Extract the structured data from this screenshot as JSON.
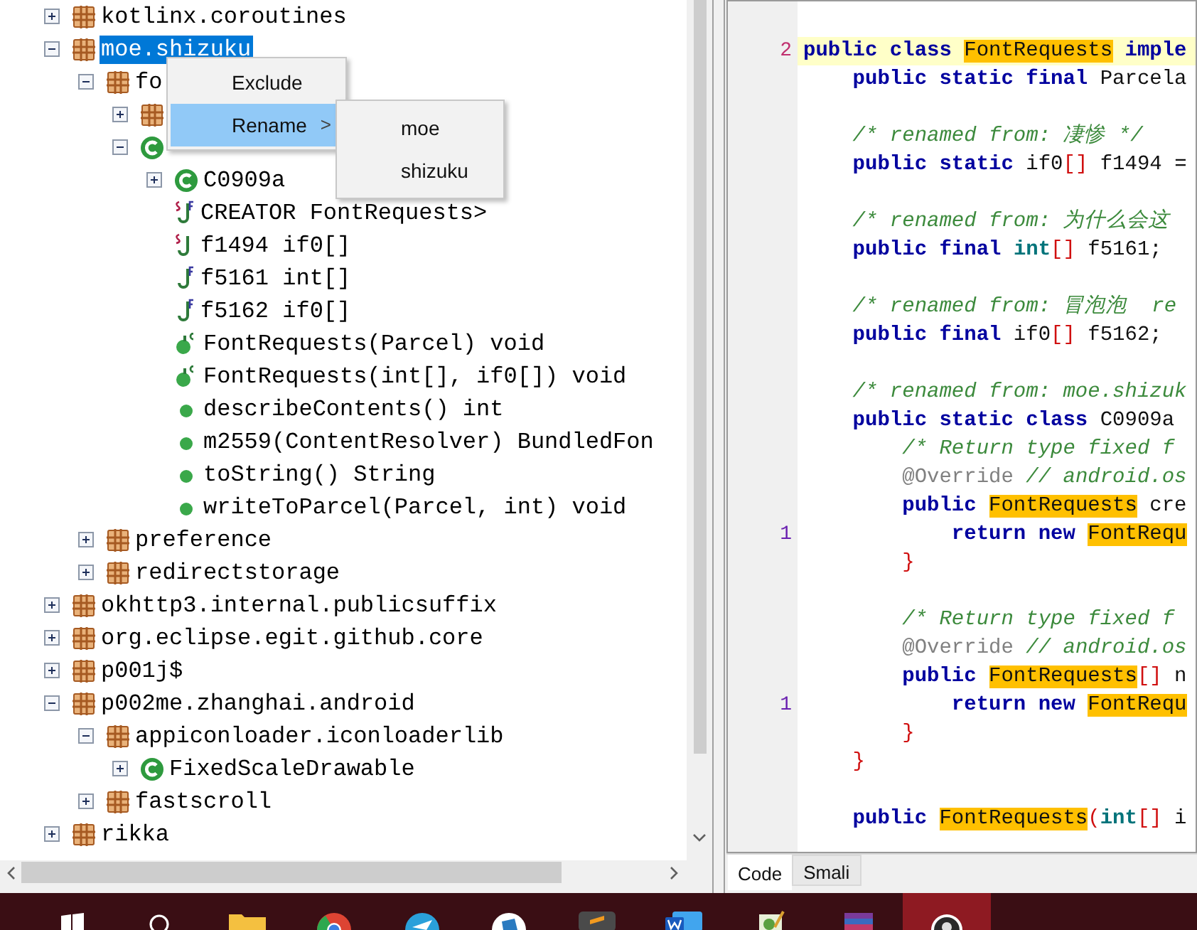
{
  "tree": {
    "nodes": [
      {
        "kind": "package",
        "label": "kotlinx.coroutines",
        "expanded": false,
        "selected": false
      },
      {
        "kind": "package",
        "label": "moe.shizuku",
        "expanded": true,
        "selected": true,
        "children": [
          {
            "kind": "package",
            "label": "fo",
            "expanded": true,
            "selected": false,
            "children": [
              {
                "kind": "package",
                "expanded": false,
                "selected": false
              },
              {
                "kind": "class",
                "expanded": true,
                "selected": false,
                "children": [
                  {
                    "kind": "class",
                    "label": "C0909a",
                    "expanded": false,
                    "selected": false
                  },
                  {
                    "kind": "field",
                    "static": true,
                    "final": true,
                    "label": "CREATOR FontRequests>",
                    "selected": false
                  },
                  {
                    "kind": "field",
                    "static": true,
                    "final": false,
                    "label": "f1494 if0[]",
                    "selected": false
                  },
                  {
                    "kind": "field",
                    "static": false,
                    "final": true,
                    "label": "f5161 int[]",
                    "selected": false
                  },
                  {
                    "kind": "field",
                    "static": false,
                    "final": true,
                    "label": "f5162 if0[]",
                    "selected": false
                  },
                  {
                    "kind": "constructor",
                    "label": "FontRequests(Parcel) void",
                    "selected": false
                  },
                  {
                    "kind": "constructor",
                    "label": "FontRequests(int[], if0[]) void",
                    "selected": false
                  },
                  {
                    "kind": "method",
                    "label": "describeContents() int",
                    "selected": false
                  },
                  {
                    "kind": "method",
                    "label": "m2559(ContentResolver) BundledFon",
                    "selected": false
                  },
                  {
                    "kind": "method",
                    "label": "toString() String",
                    "selected": false
                  },
                  {
                    "kind": "method",
                    "label": "writeToParcel(Parcel, int) void",
                    "selected": false
                  }
                ]
              }
            ]
          },
          {
            "kind": "package",
            "label": "preference",
            "expanded": false,
            "selected": false
          },
          {
            "kind": "package",
            "label": "redirectstorage",
            "expanded": false,
            "selected": false
          }
        ]
      },
      {
        "kind": "package",
        "label": "okhttp3.internal.publicsuffix",
        "expanded": false,
        "selected": false
      },
      {
        "kind": "package",
        "label": "org.eclipse.egit.github.core",
        "expanded": false,
        "selected": false
      },
      {
        "kind": "package",
        "label": "p001j$",
        "expanded": false,
        "selected": false
      },
      {
        "kind": "package",
        "label": "p002me.zhanghai.android",
        "expanded": true,
        "selected": false,
        "children": [
          {
            "kind": "package",
            "label": "appiconloader.iconloaderlib",
            "expanded": true,
            "selected": false,
            "children": [
              {
                "kind": "class",
                "label": "FixedScaleDrawable",
                "expanded": false,
                "selected": false
              }
            ]
          },
          {
            "kind": "package",
            "label": "fastscroll",
            "expanded": false,
            "selected": false
          }
        ]
      },
      {
        "kind": "package",
        "label": "rikka",
        "expanded": false,
        "selected": false
      }
    ]
  },
  "context_menu": {
    "items": [
      {
        "label": "Exclude",
        "selected": false
      },
      {
        "label": "Rename",
        "selected": true,
        "arrow": ">"
      }
    ]
  },
  "submenu": {
    "items": [
      {
        "label": "moe",
        "selected": false
      },
      {
        "label": "shizuku",
        "selected": false
      }
    ]
  },
  "editor": {
    "lines": [
      {
        "gutter": "2",
        "highlight": true,
        "tokens": [
          {
            "text": "public class ",
            "kind": "keyword"
          },
          {
            "text": "FontRequests",
            "kind": "match"
          },
          {
            "text": " imple",
            "kind": "keyword"
          }
        ]
      },
      {
        "highlight": false,
        "tokens": [
          {
            "text": "    public static final",
            "kind": "keyword"
          },
          {
            "text": " Parcela",
            "kind": "plain"
          }
        ]
      },
      {
        "highlight": false
      },
      {
        "highlight": false,
        "tokens": [
          {
            "text": "    /* renamed from: 凄惨 */",
            "kind": "comment"
          }
        ]
      },
      {
        "highlight": false,
        "tokens": [
          {
            "text": "    public static",
            "kind": "keyword"
          },
          {
            "text": " if0",
            "kind": "plain"
          },
          {
            "text": "[]",
            "kind": "bracket"
          },
          {
            "text": " f1494 =",
            "kind": "plain"
          }
        ]
      },
      {
        "highlight": false
      },
      {
        "highlight": false,
        "tokens": [
          {
            "text": "    /* renamed from: 为什么会这",
            "kind": "comment"
          }
        ]
      },
      {
        "highlight": false,
        "tokens": [
          {
            "text": "    public final ",
            "kind": "keyword"
          },
          {
            "text": "int",
            "kind": "type"
          },
          {
            "text": "[]",
            "kind": "bracket"
          },
          {
            "text": " f5161;",
            "kind": "plain"
          }
        ]
      },
      {
        "highlight": false
      },
      {
        "highlight": false,
        "tokens": [
          {
            "text": "    /* renamed from: 冒泡泡  re",
            "kind": "comment"
          }
        ]
      },
      {
        "highlight": false,
        "tokens": [
          {
            "text": "    public final",
            "kind": "keyword"
          },
          {
            "text": " if0",
            "kind": "plain"
          },
          {
            "text": "[]",
            "kind": "bracket"
          },
          {
            "text": " f5162;",
            "kind": "plain"
          }
        ]
      },
      {
        "highlight": false
      },
      {
        "highlight": false,
        "tokens": [
          {
            "text": "    /* renamed from: moe.shizuk",
            "kind": "comment"
          }
        ]
      },
      {
        "highlight": false,
        "tokens": [
          {
            "text": "    public static class",
            "kind": "keyword"
          },
          {
            "text": " C0909a",
            "kind": "plain"
          }
        ]
      },
      {
        "highlight": false,
        "tokens": [
          {
            "text": "        /* Return type fixed f",
            "kind": "comment"
          }
        ]
      },
      {
        "highlight": false,
        "tokens": [
          {
            "text": "        @Override",
            "kind": "annotation"
          },
          {
            "text": " // android.os",
            "kind": "comment"
          }
        ]
      },
      {
        "highlight": false,
        "tokens": [
          {
            "text": "        public ",
            "kind": "keyword"
          },
          {
            "text": "FontRequests",
            "kind": "match"
          },
          {
            "text": " cre",
            "kind": "plain"
          }
        ]
      },
      {
        "gutter": "1",
        "highlight": false,
        "tokens": [
          {
            "text": "            return new ",
            "kind": "keyword"
          },
          {
            "text": "FontRequ",
            "kind": "match"
          }
        ]
      },
      {
        "highlight": false,
        "tokens": [
          {
            "text": "        }",
            "kind": "bracket"
          }
        ]
      },
      {
        "highlight": false
      },
      {
        "highlight": false,
        "tokens": [
          {
            "text": "        /* Return type fixed f",
            "kind": "comment"
          }
        ]
      },
      {
        "highlight": false,
        "tokens": [
          {
            "text": "        @Override",
            "kind": "annotation"
          },
          {
            "text": " // android.os",
            "kind": "comment"
          }
        ]
      },
      {
        "highlight": false,
        "tokens": [
          {
            "text": "        public ",
            "kind": "keyword"
          },
          {
            "text": "FontRequests",
            "kind": "match"
          },
          {
            "text": "[]",
            "kind": "bracket"
          },
          {
            "text": " n",
            "kind": "plain"
          }
        ]
      },
      {
        "gutter": "1",
        "highlight": false,
        "tokens": [
          {
            "text": "            return new ",
            "kind": "keyword"
          },
          {
            "text": "FontRequ",
            "kind": "match"
          }
        ]
      },
      {
        "highlight": false,
        "tokens": [
          {
            "text": "        }",
            "kind": "bracket"
          }
        ]
      },
      {
        "highlight": false,
        "tokens": [
          {
            "text": "    }",
            "kind": "bracket"
          }
        ]
      },
      {
        "highlight": false
      },
      {
        "highlight": false,
        "tokens": [
          {
            "text": "    public ",
            "kind": "keyword"
          },
          {
            "text": "FontRequests",
            "kind": "match"
          },
          {
            "text": "(",
            "kind": "bracket"
          },
          {
            "text": "int",
            "kind": "type"
          },
          {
            "text": "[]",
            "kind": "bracket"
          },
          {
            "text": " i",
            "kind": "plain"
          }
        ]
      }
    ],
    "tabs": [
      {
        "label": "Code",
        "selected": true
      },
      {
        "label": "Smali",
        "selected": false
      }
    ]
  },
  "taskbar": {
    "apps": [
      {
        "kind": "start",
        "selected": false
      },
      {
        "kind": "search",
        "selected": false
      },
      {
        "kind": "folder",
        "selected": false
      },
      {
        "kind": "chrome",
        "selected": false
      },
      {
        "kind": "telegram",
        "selected": false
      },
      {
        "kind": "photos",
        "selected": false
      },
      {
        "kind": "sublime",
        "selected": false
      },
      {
        "kind": "word",
        "selected": false
      },
      {
        "kind": "notepad",
        "selected": false
      },
      {
        "kind": "archive",
        "selected": false
      },
      {
        "kind": "avatar",
        "selected": true
      }
    ]
  }
}
